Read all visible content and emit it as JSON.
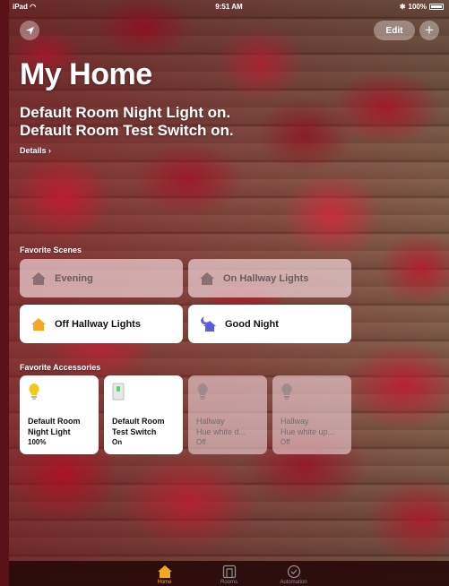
{
  "status_bar": {
    "device": "iPad",
    "time": "9:51 AM",
    "battery": "100%"
  },
  "header": {
    "edit_label": "Edit",
    "add_label": "+"
  },
  "title": "My Home",
  "summary": {
    "line1": "Default Room Night Light on.",
    "line2": "Default Room Test Switch on."
  },
  "details_label": "Details ›",
  "scenes": {
    "label": "Favorite Scenes",
    "items": [
      {
        "name": "Evening",
        "active": false,
        "icon": "house-icon"
      },
      {
        "name": "On Hallway Lights",
        "active": false,
        "icon": "house-icon"
      },
      {
        "name": "Off Hallway Lights",
        "active": true,
        "icon": "house-icon"
      },
      {
        "name": "Good Night",
        "active": true,
        "icon": "moon-house-icon"
      }
    ]
  },
  "accessories": {
    "label": "Favorite Accessories",
    "items": [
      {
        "name1": "Default Room",
        "name2": "Night Light",
        "state": "100%",
        "active": true,
        "icon": "lightbulb-icon"
      },
      {
        "name1": "Default Room",
        "name2": "Test Switch",
        "state": "On",
        "active": true,
        "icon": "switch-icon"
      },
      {
        "name1": "Hallway",
        "name2": "Hue white  d...",
        "state": "Off",
        "active": false,
        "icon": "lightbulb-icon"
      },
      {
        "name1": "Hallway",
        "name2": "Hue white up...",
        "state": "Off",
        "active": false,
        "icon": "lightbulb-icon"
      }
    ]
  },
  "tabs": [
    {
      "label": "Home",
      "active": true,
      "icon": "home-icon"
    },
    {
      "label": "Rooms",
      "active": false,
      "icon": "rooms-icon"
    },
    {
      "label": "Automation",
      "active": false,
      "icon": "automation-icon"
    }
  ],
  "colors": {
    "accent": "#f5a623",
    "scene_icon_on": "#f5a623",
    "night_icon": "#5a5ce0"
  }
}
